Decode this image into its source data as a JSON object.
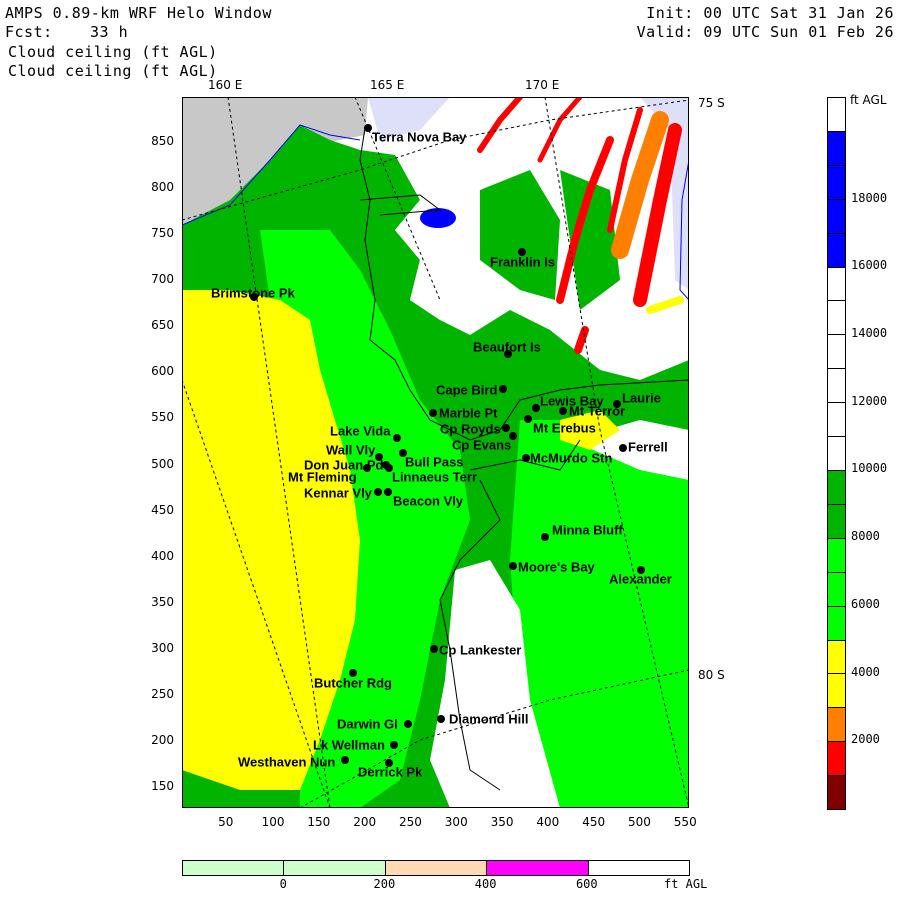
{
  "header": {
    "title": "AMPS 0.89-km WRF Helo Window",
    "forecast_label": "Fcst:",
    "forecast_hours": "33 h",
    "field_line1": "Cloud ceiling (ft AGL)",
    "field_line2": "Cloud ceiling (ft AGL)",
    "init": "Init: 00 UTC Sat 31 Jan 26",
    "valid": "Valid: 09 UTC Sun 01 Feb 26"
  },
  "map": {
    "lon_labels": [
      "160 E",
      "165 E",
      "170 E"
    ],
    "lat_labels": [
      "75 S",
      "80 S"
    ],
    "x_ticks": [
      "50",
      "100",
      "150",
      "200",
      "250",
      "300",
      "350",
      "400",
      "450",
      "500",
      "550"
    ],
    "y_ticks": [
      "850",
      "800",
      "750",
      "700",
      "650",
      "600",
      "550",
      "500",
      "450",
      "400",
      "350",
      "300",
      "250",
      "200",
      "150"
    ],
    "stations": [
      "Terra Nova Bay",
      "Franklin Is",
      "Brimstone Pk",
      "Beaufort Is",
      "Cape Bird",
      "Marble Pt",
      "Lewis Bay",
      "Mt Terror",
      "Laurie",
      "Cp Royds",
      "Mt Erebus",
      "Lake Vida",
      "Cp Evans",
      "Wall Vly",
      "Bull Pass",
      "Don Juan Pd",
      "McMurdo Stn",
      "Ferrell",
      "Mt Fleming",
      "Linnaeus Terr",
      "Kennar Vly",
      "Beacon Vly",
      "Minna Bluff",
      "Moore's Bay",
      "Alexander",
      "Cp Lankester",
      "Butcher Rdg",
      "Darwin Gl",
      "Diamond Hill",
      "Lk Wellman",
      "Westhaven Nun",
      "Derrick Pk"
    ]
  },
  "colorbar": {
    "units": "ft AGL",
    "labels": [
      "18000",
      "16000",
      "14000",
      "12000",
      "10000",
      "8000",
      "6000",
      "4000",
      "2000"
    ],
    "colors": [
      "#ffffff",
      "#0000ff",
      "#0000ff",
      "#0000ff",
      "#0000ff",
      "#ffffff",
      "#ffffff",
      "#ffffff",
      "#ffffff",
      "#ffffff",
      "#ffffff",
      "#00b400",
      "#00b400",
      "#00ff00",
      "#00ff00",
      "#00ff00",
      "#ffff00",
      "#ffff00",
      "#ff8000",
      "#ff0000",
      "#800000"
    ]
  },
  "terrain_bar": {
    "units": "ft AGL",
    "labels": [
      "0",
      "200",
      "400",
      "600"
    ],
    "colors": [
      "#ccffcc",
      "#ccffcc",
      "#ffd8b4",
      "#ff00ff",
      "#ffffff"
    ]
  }
}
